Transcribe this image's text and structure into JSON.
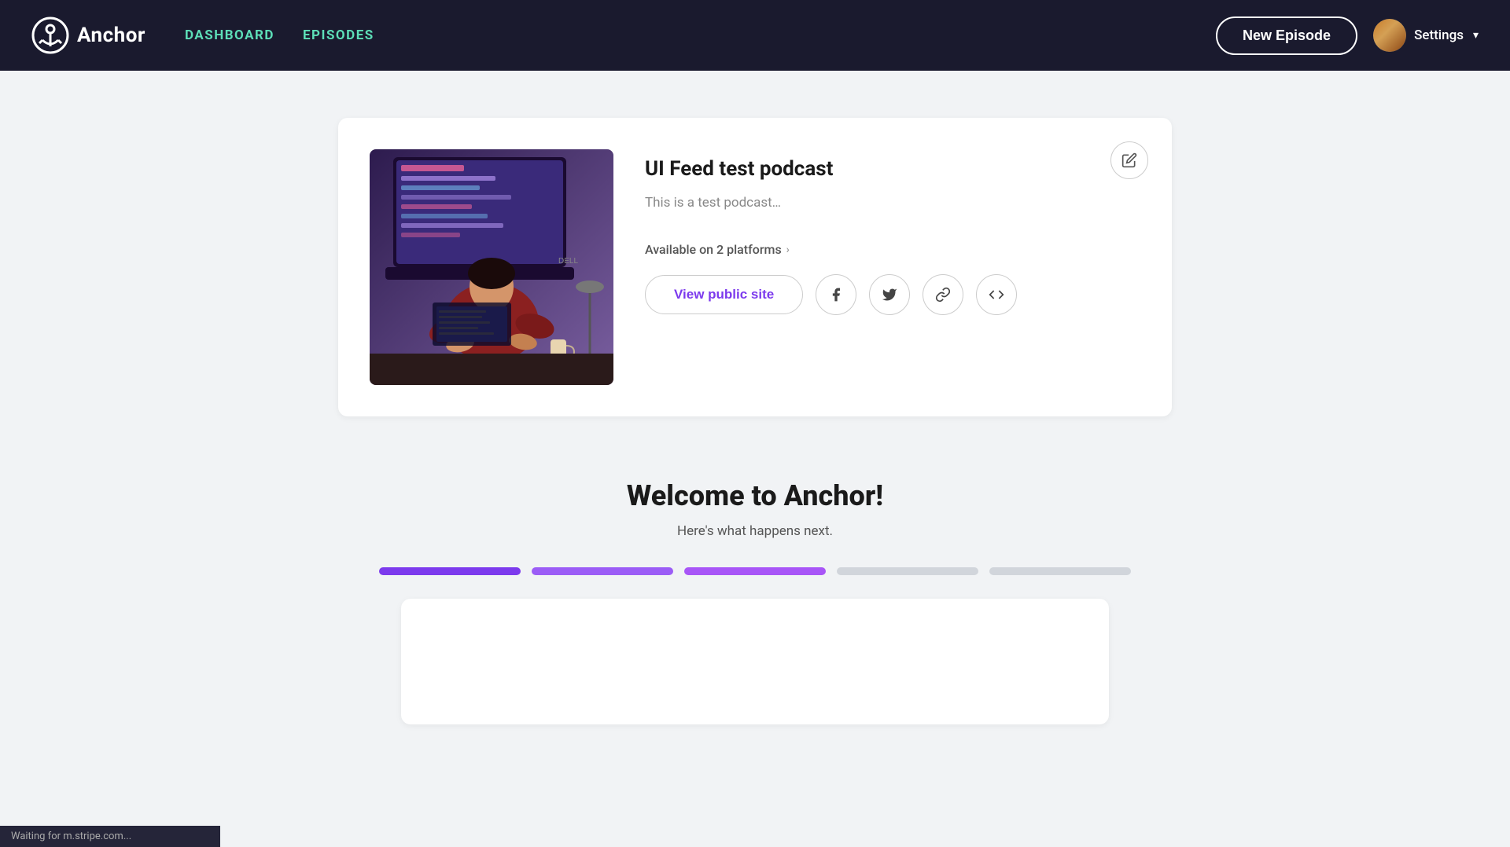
{
  "nav": {
    "logo_text": "Anchor",
    "links": [
      {
        "id": "dashboard",
        "label": "DASHBOARD"
      },
      {
        "id": "episodes",
        "label": "EPISODES"
      }
    ],
    "new_episode_label": "New Episode",
    "settings_label": "Settings"
  },
  "podcast": {
    "title": "UI Feed test podcast",
    "description": "This is a test podcast…",
    "platforms_label": "Available on 2 platforms",
    "view_public_label": "View public site"
  },
  "welcome": {
    "title": "Welcome to Anchor!",
    "subtitle": "Here's what happens next.",
    "steps": [
      {
        "id": "step-1",
        "state": "active-1"
      },
      {
        "id": "step-2",
        "state": "active-2"
      },
      {
        "id": "step-3",
        "state": "active-3"
      },
      {
        "id": "step-4",
        "state": "inactive"
      },
      {
        "id": "step-5",
        "state": "inactive"
      }
    ]
  },
  "status_bar": {
    "text": "Waiting for m.stripe.com..."
  },
  "icons": {
    "edit": "✏",
    "facebook": "f",
    "twitter": "t",
    "link": "🔗",
    "code": "</>",
    "chevron_right": "›",
    "chevron_down": "▾"
  }
}
